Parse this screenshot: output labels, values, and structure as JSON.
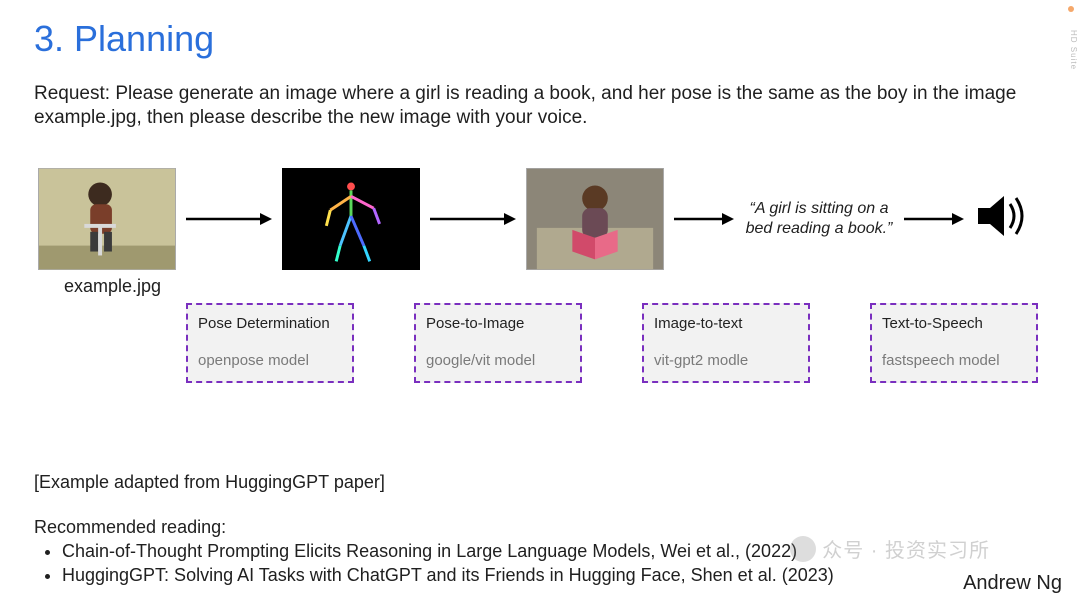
{
  "title": "3. Planning",
  "request": "Request: Please generate an image where a girl is reading a book, and her pose is the same as the boy in the image example.jpg, then please describe the new image with your voice.",
  "example_label": "example.jpg",
  "caption": "“A girl is sitting on a bed reading a book.”",
  "boxes": [
    {
      "title": "Pose Determination",
      "sub": "openpose model"
    },
    {
      "title": "Pose-to-Image",
      "sub": "google/vit model"
    },
    {
      "title": "Image-to-text",
      "sub": "vit-gpt2 modle"
    },
    {
      "title": "Text-to-Speech",
      "sub": "fastspeech model"
    }
  ],
  "adapted": "[Example adapted from HuggingGPT paper]",
  "rec_heading": "Recommended reading:",
  "rec_items": [
    "Chain-of-Thought Prompting Elicits Reasoning in Large Language Models, Wei et al., (2022)",
    "HuggingGPT: Solving AI Tasks with ChatGPT and its Friends in Hugging Face, Shen et al. (2023)"
  ],
  "author": "Andrew Ng",
  "watermark": "众号 · 投资实习所",
  "sidebar_label": "HD Suite"
}
